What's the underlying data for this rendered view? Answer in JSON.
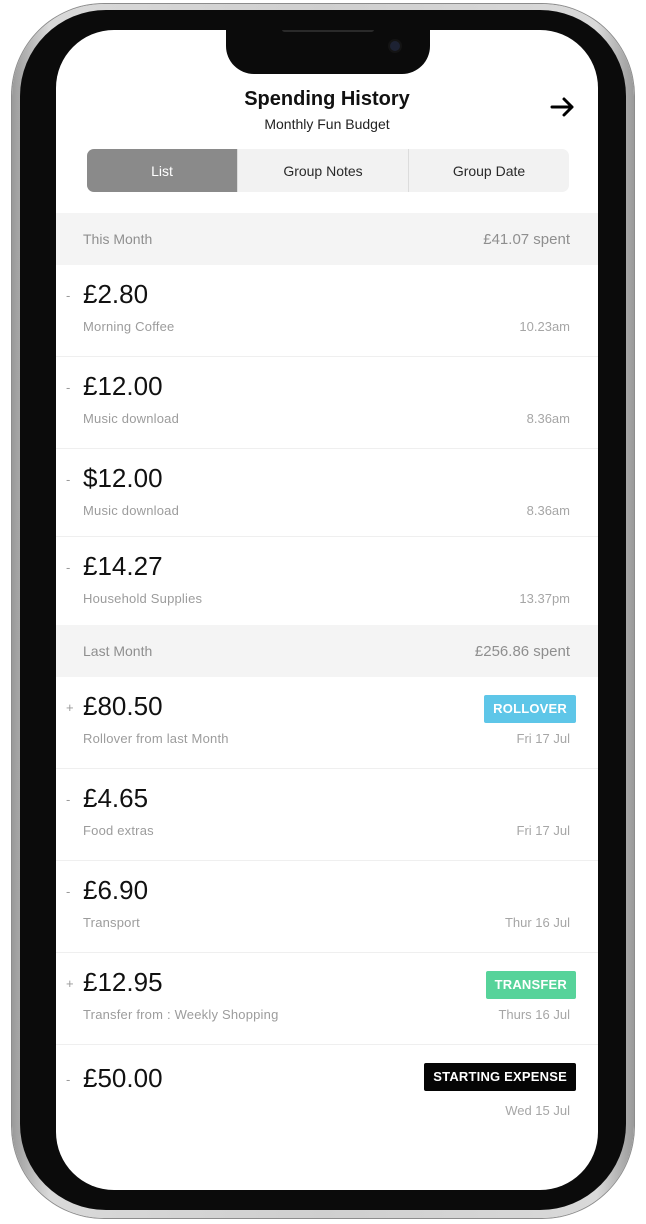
{
  "header": {
    "title": "Spending History",
    "subtitle": "Monthly Fun Budget",
    "next_icon": "arrow-right-icon"
  },
  "tabs": [
    {
      "label": "List",
      "active": true
    },
    {
      "label": "Group Notes",
      "active": false
    },
    {
      "label": "Group Date",
      "active": false
    }
  ],
  "sections": [
    {
      "label": "This Month",
      "total": "£41.07 spent",
      "items": [
        {
          "sign": "-",
          "amount": "£2.80",
          "description": "Morning Coffee",
          "time": "10.23am"
        },
        {
          "sign": "-",
          "amount": "£12.00",
          "description": "Music download",
          "time": "8.36am"
        },
        {
          "sign": "-",
          "amount": "$12.00",
          "description": "Music download",
          "time": "8.36am"
        },
        {
          "sign": "-",
          "amount": "£14.27",
          "description": "Household Supplies",
          "time": "13.37pm"
        }
      ]
    },
    {
      "label": "Last Month",
      "total": "£256.86 spent",
      "items": [
        {
          "sign": "+",
          "amount": "£80.50",
          "description": "Rollover from last Month",
          "time": "Fri 17 Jul",
          "badge": "ROLLOVER"
        },
        {
          "sign": "-",
          "amount": "£4.65",
          "description": "Food extras",
          "time": "Fri 17 Jul"
        },
        {
          "sign": "-",
          "amount": "£6.90",
          "description": "Transport",
          "time": "Thur 16 Jul"
        },
        {
          "sign": "+",
          "amount": "£12.95",
          "description": "Transfer from : Weekly Shopping",
          "time": "Thurs 16 Jul",
          "badge": "TRANSFER"
        },
        {
          "sign": "-",
          "amount": "£50.00",
          "description": "",
          "time": "Wed 15 Jul",
          "badge": "STARTING EXPENSE"
        }
      ]
    }
  ],
  "colors": {
    "active_tab": "#8a8a8a",
    "rollover_badge": "#5ec6e8",
    "transfer_badge": "#57d39a",
    "starting_badge": "#050505"
  }
}
